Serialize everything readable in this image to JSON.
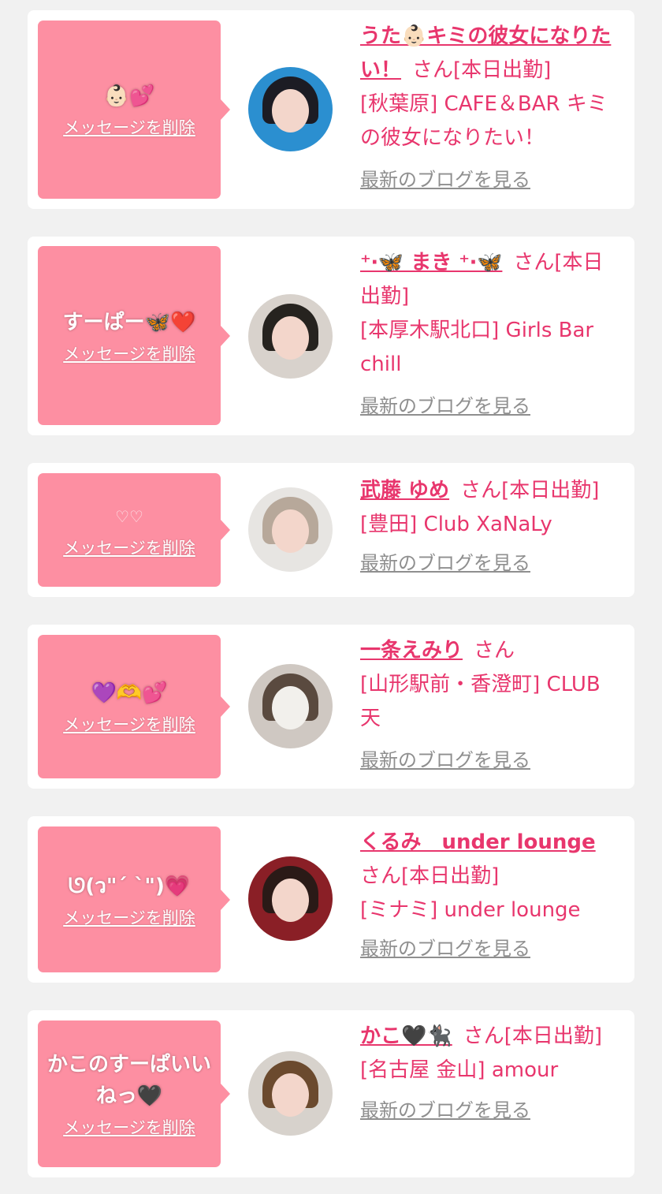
{
  "delete_label": "メッセージを削除",
  "blog_label": "最新のブログを見る",
  "san_label": "さん",
  "cards": [
    {
      "message": "👶🏻💕",
      "name": "うた👶🏻キミの彼女になりたい！",
      "status": "さん[本日出勤]",
      "shop": "[秋葉原] CAFE＆BAR キミの彼女になりたい！"
    },
    {
      "message": "すーぱー🦋❤️",
      "name": "⁺‧🦋 まき ⁺‧🦋",
      "status": "さん[本日出勤]",
      "shop": "[本厚木駅北口] Girls Bar chill"
    },
    {
      "message": "♡♡",
      "name": "武藤 ゆめ",
      "status": "さん[本日出勤]",
      "shop": "[豊田] Club XaNaLy"
    },
    {
      "message": "💜🫶💕",
      "name": "一条えみり",
      "status": "さん",
      "shop": "[山形駅前・香澄町] CLUB 天"
    },
    {
      "message": "ᘎ(ว\"ˊ ˋ\")💗",
      "name": "くるみ　under lounge",
      "status": "さん[本日出勤]",
      "shop": "[ミナミ] under lounge"
    },
    {
      "message": "かこのすーぱいいねっ🖤",
      "name": "かこ🖤🐈‍⬛",
      "status": "さん[本日出勤]",
      "shop": "[名古屋 金山] amour"
    }
  ]
}
